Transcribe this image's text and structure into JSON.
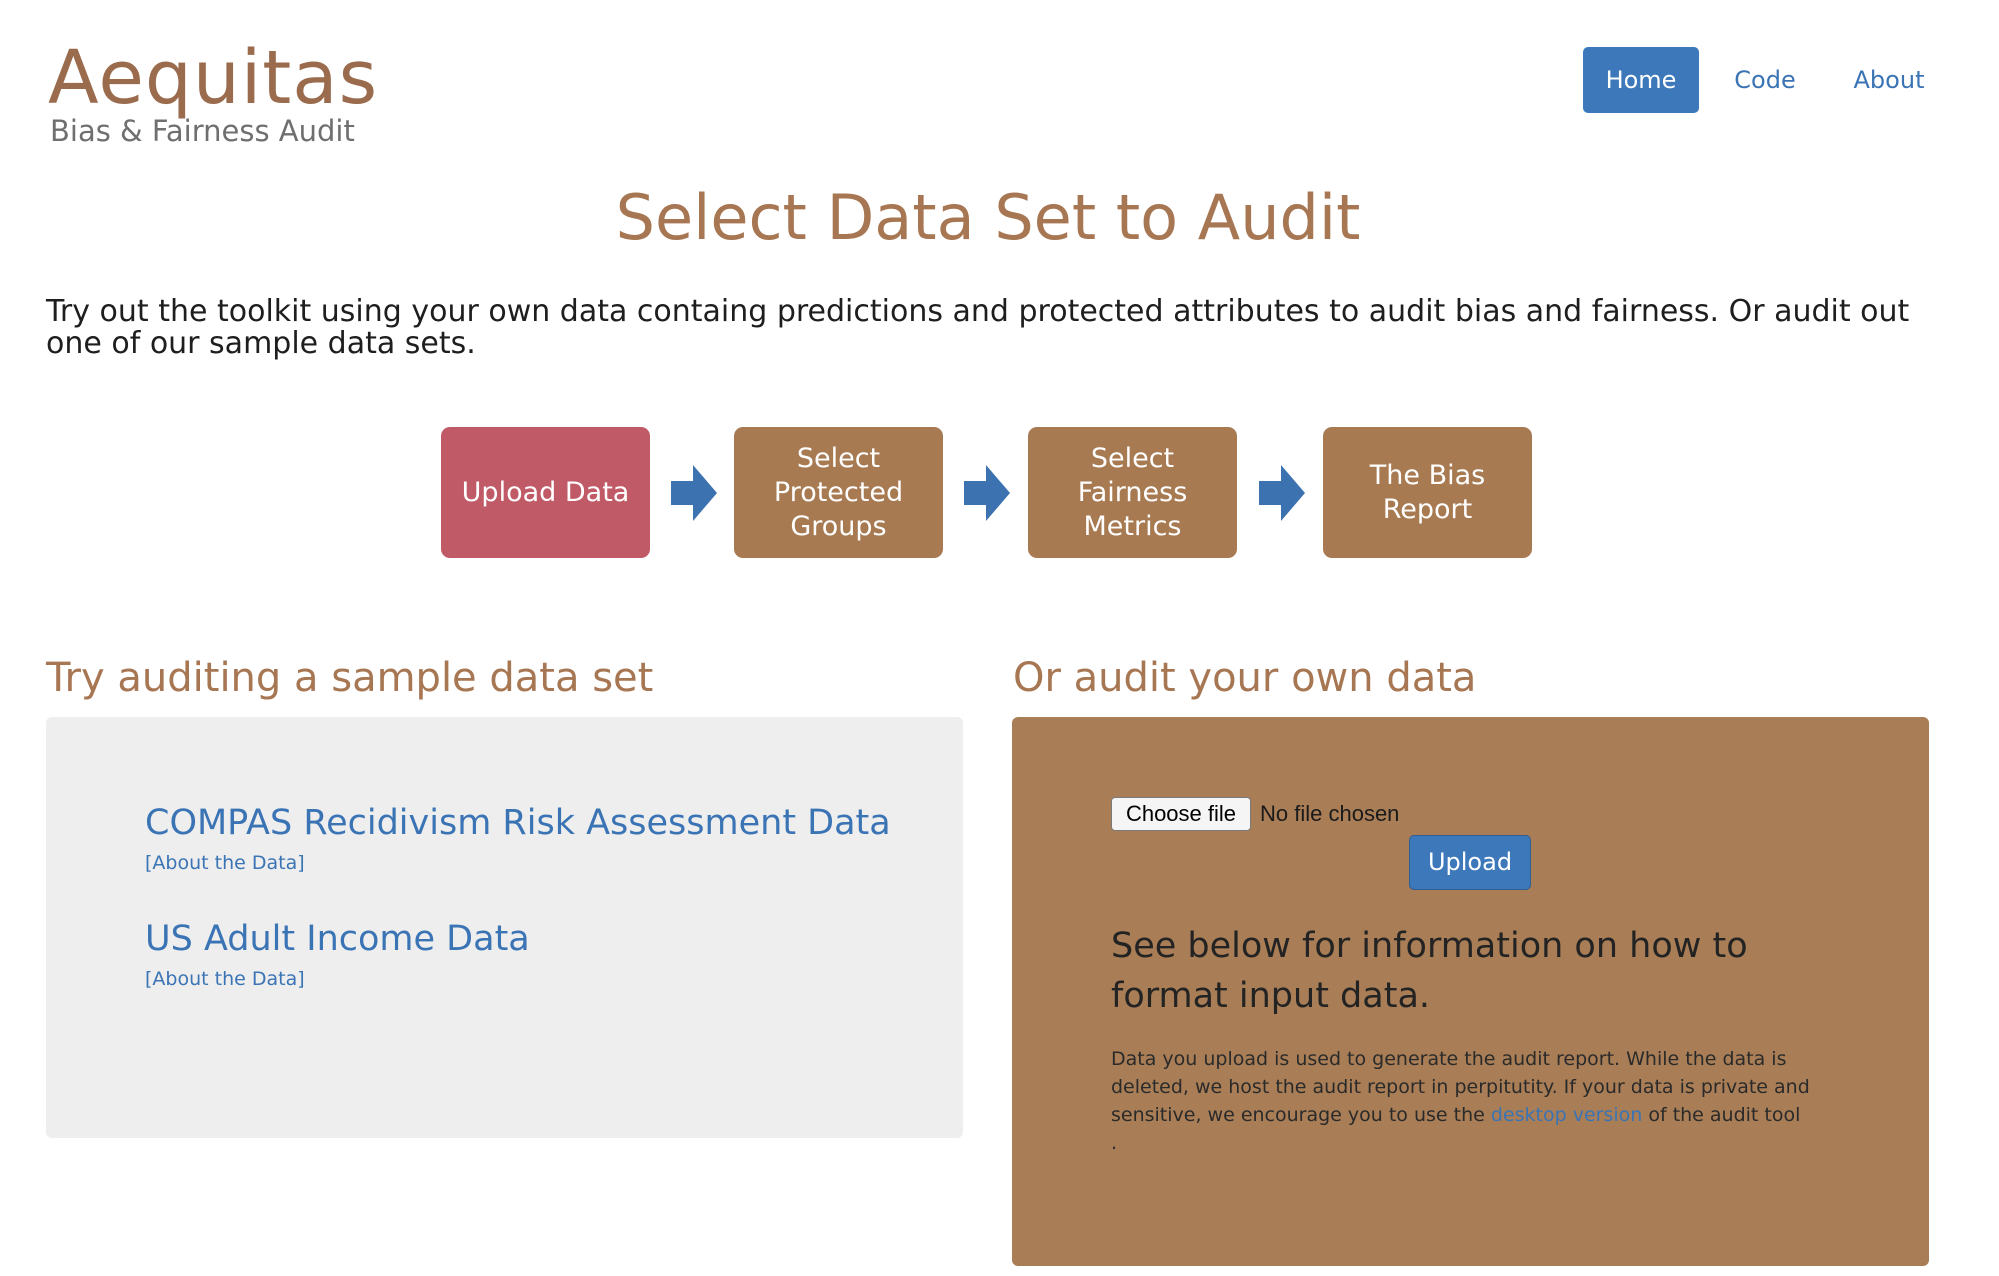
{
  "logo": {
    "title": "Aequitas",
    "subtitle": "Bias & Fairness Audit"
  },
  "nav": {
    "home": "Home",
    "code": "Code",
    "about": "About"
  },
  "page_title": "Select Data Set to Audit",
  "intro": "Try out the toolkit using your own data containg predictions and protected attributes to audit bias and fairness. Or audit out one of our sample data sets.",
  "flow": {
    "steps": [
      "Upload Data",
      "Select Protected Groups",
      "Select Fairness Metrics",
      "The Bias Report"
    ],
    "active_step": "Upload Data",
    "arrow_icon": "right-arrow-icon"
  },
  "sample": {
    "heading": "Try auditing a sample data set",
    "datasets": [
      {
        "title": "COMPAS Recidivism Risk Assessment Data",
        "about": "[About the Data]"
      },
      {
        "title": "US Adult Income Data",
        "about": "[About the Data]"
      }
    ]
  },
  "own": {
    "heading": "Or audit your own data",
    "choose_file": "Choose file",
    "no_file": "No file chosen",
    "upload": "Upload",
    "format_info": "See below for information on how to format input data.",
    "privacy_before": "Data you upload is used to generate the audit report. While the data is deleted, we host the audit report in perpitutity. If your data is private and sensitive, we encourage you to use the ",
    "privacy_link": "desktop version",
    "privacy_after": " of the audit tool",
    "privacy_end": "."
  },
  "colors": {
    "brand_brown": "#a87a52",
    "active_step": "#c05a66",
    "link_blue": "#3b74b5",
    "nav_active": "#3c78ba"
  }
}
